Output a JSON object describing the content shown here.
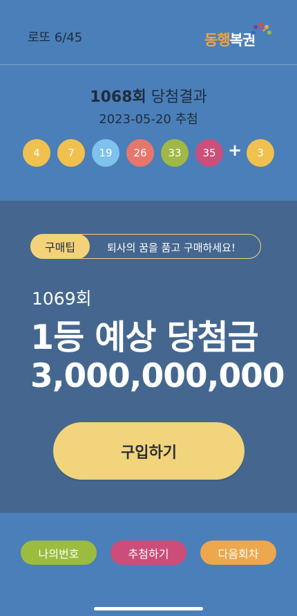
{
  "header": {
    "game_label": "로또 6/45",
    "brand_part1": "동행",
    "brand_part2": "복권"
  },
  "result": {
    "round": "1068회",
    "title_suffix": "당첨결과",
    "date": "2023-05-20 추첨",
    "numbers": [
      {
        "value": "4",
        "color": "#f0c14f"
      },
      {
        "value": "7",
        "color": "#f0c14f"
      },
      {
        "value": "19",
        "color": "#7fc2ee"
      },
      {
        "value": "26",
        "color": "#e7776d"
      },
      {
        "value": "33",
        "color": "#a0b846"
      },
      {
        "value": "35",
        "color": "#cb4f7a"
      }
    ],
    "plus": "+",
    "bonus": {
      "value": "3",
      "color": "#f0c14f"
    }
  },
  "main": {
    "tip_label": "구매팁",
    "tip_text": "퇴사의 꿈을 품고 구매하세요!",
    "next_round": "1069회",
    "headline": "1등 예상 당첨금",
    "amount": "3,000,000,000",
    "buy_label": "구입하기"
  },
  "footer": {
    "buttons": [
      {
        "label": "나의번호",
        "color": "#9bbc3f"
      },
      {
        "label": "추첨하기",
        "color": "#cc4d7a"
      },
      {
        "label": "다음회차",
        "color": "#eda74c"
      }
    ]
  },
  "colors": {
    "background": "#4b7fb9",
    "panel": "#45678f",
    "accent_yellow": "#f2d47c"
  }
}
